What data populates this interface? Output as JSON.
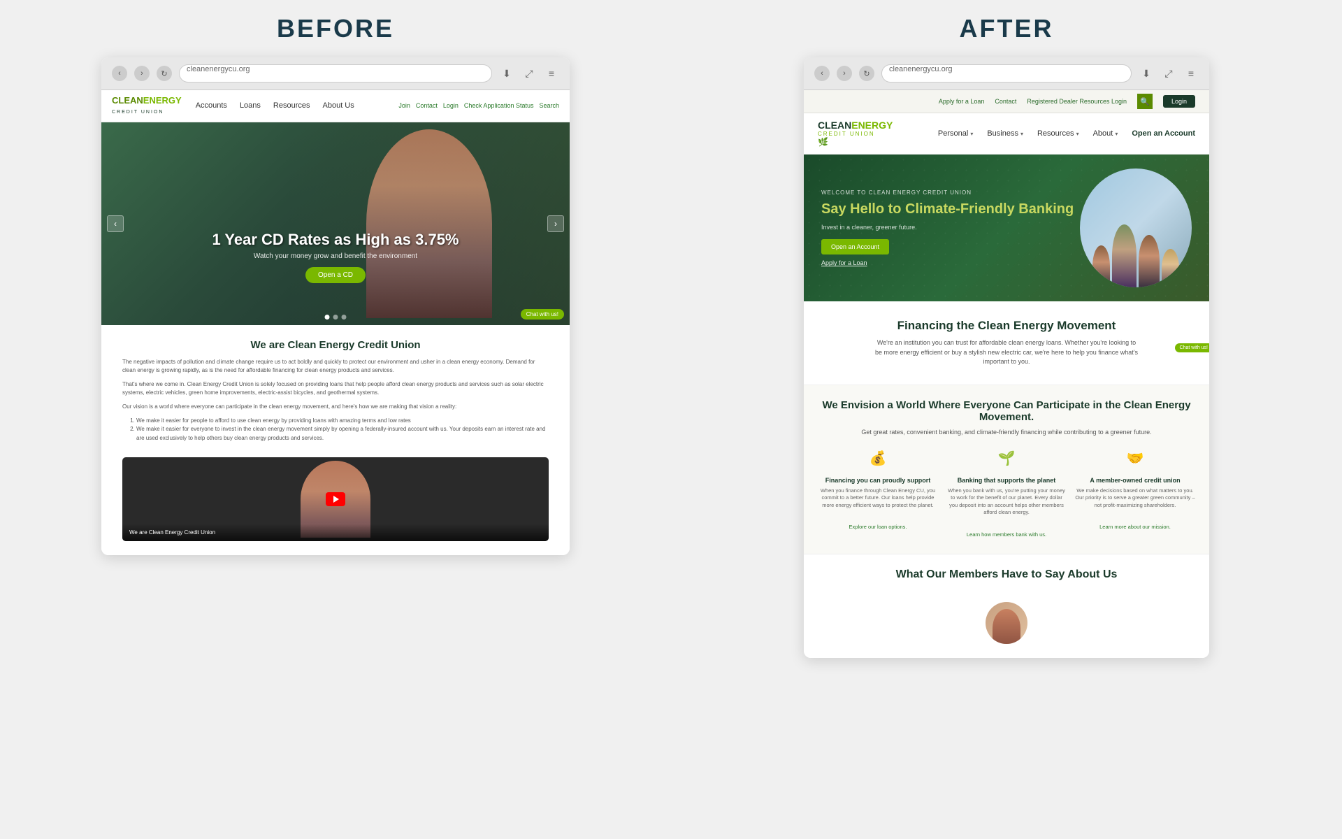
{
  "layout": {
    "before_label": "BEFORE",
    "after_label": "AFTER"
  },
  "before": {
    "browser": {
      "address": "cleanenergycu.org",
      "download_icon": "⬇",
      "expand_icon": "⤢",
      "menu_icon": "≡",
      "back_icon": "‹",
      "forward_icon": "›",
      "reload_icon": "↻"
    },
    "header": {
      "logo_clean": "CLEAN",
      "logo_energy": "ENERGY",
      "logo_sub": "CREDIT UNION",
      "nav": [
        "Accounts",
        "Loans",
        "Resources",
        "About Us"
      ],
      "nav_right": [
        "Join",
        "Contact",
        "Login",
        "Check Application Status",
        "Search"
      ]
    },
    "hero": {
      "title": "1 Year CD Rates as High as 3.75%",
      "subtitle": "Watch your money grow and benefit the environment",
      "cta": "Open a CD",
      "chat": "Chat with us!"
    },
    "about": {
      "heading": "We are Clean Energy Credit Union",
      "para1": "The negative impacts of pollution and climate change require us to act boldly and quickly to protect our environment and usher in a clean energy economy. Demand for clean energy is growing rapidly, as is the need for affordable financing for clean energy products and services.",
      "para2": "That's where we come in. Clean Energy Credit Union is solely focused on providing loans that help people afford clean energy products and services such as solar electric systems, electric vehicles, green home improvements, electric-assist bicycles, and geothermal systems.",
      "para3": "Our vision is a world where everyone can participate in the clean energy movement, and here's how we are making that vision a reality:",
      "list1": "We make it easier for people to afford to use clean energy by providing loans with amazing terms and low rates",
      "list2": "We make it easier for everyone to invest in the clean energy movement simply by opening a federally-insured account with us. Your deposits earn an interest rate and are used exclusively to help others buy clean energy products and services."
    },
    "video": {
      "title": "We are Clean Energy Credit Union"
    }
  },
  "after": {
    "browser": {
      "address": "cleanenergycu.org",
      "back_icon": "‹",
      "forward_icon": "›",
      "reload_icon": "↻",
      "download_icon": "⬇",
      "expand_icon": "⤢",
      "menu_icon": "≡"
    },
    "topbar": {
      "apply_loan": "Apply for a Loan",
      "contact": "Contact",
      "dealer_login": "Registered Dealer Resources Login",
      "login_btn": "Login"
    },
    "header": {
      "logo_clean": "CLEAN",
      "logo_energy": "ENERGY",
      "logo_sub": "CREDIT UNION",
      "nav": [
        {
          "label": "Personal",
          "has_dropdown": true
        },
        {
          "label": "Business",
          "has_dropdown": true
        },
        {
          "label": "Resources",
          "has_dropdown": true
        },
        {
          "label": "About",
          "has_dropdown": true
        }
      ],
      "cta": "Open an Account"
    },
    "hero": {
      "eyebrow": "WELCOME TO CLEAN ENERGY CREDIT UNION",
      "title": "Say Hello to Climate-Friendly Banking",
      "subtitle": "Invest in a cleaner, greener future.",
      "btn_primary": "Open an Account",
      "btn_link": "Apply for a Loan"
    },
    "section1": {
      "heading": "Financing the Clean Energy Movement",
      "body": "We're an institution you can trust for affordable clean energy loans. Whether you're looking to be more energy efficient or buy a stylish new electric car, we're here to help you finance what's important to you.",
      "chat": "Chat with us!"
    },
    "section2": {
      "heading": "We Envision a World Where Everyone Can Participate in the Clean Energy Movement.",
      "body": "Get great rates, convenient banking, and climate-friendly financing while contributing to a greener future.",
      "features": [
        {
          "icon": "💰",
          "title": "Financing you can proudly support",
          "body": "When you finance through Clean Energy CU, you commit to a better future. Our loans help provide more energy efficient ways to protect the planet.",
          "link": "Explore our loan options."
        },
        {
          "icon": "🌱",
          "title": "Banking that supports the planet",
          "body": "When you bank with us, you're putting your money to work for the benefit of our planet. Every dollar you deposit into an account helps other members afford clean energy.",
          "link": "Learn how members bank with us."
        },
        {
          "icon": "🤝",
          "title": "A member-owned credit union",
          "body": "We make decisions based on what matters to you. Our priority is to serve a greater green community – not profit-maximizing shareholders.",
          "link": "Learn more about our mission."
        }
      ]
    },
    "section3": {
      "heading": "What Our Members Have to Say About Us"
    }
  }
}
